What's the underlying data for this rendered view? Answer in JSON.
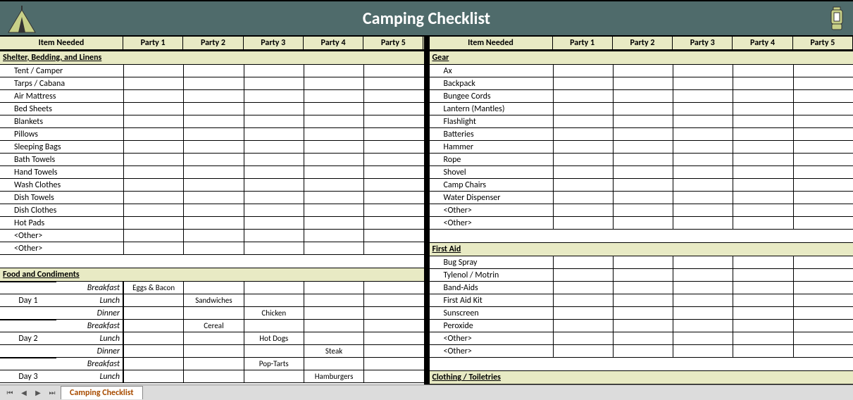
{
  "title": "Camping Checklist",
  "headers": {
    "item": "Item Needed",
    "parties": [
      "Party 1",
      "Party 2",
      "Party 3",
      "Party 4",
      "Party 5"
    ]
  },
  "left": {
    "sections": [
      {
        "name": "Shelter, Bedding, and Linens",
        "items": [
          "Tent / Camper",
          "Tarps / Cabana",
          "Air Mattress",
          "Bed Sheets",
          "Blankets",
          "Pillows",
          "Sleeping Bags",
          "Bath Towels",
          "Hand Towels",
          "Wash Clothes",
          "Dish Towels",
          "Dish Clothes",
          "Hot Pads",
          "<Other>",
          "<Other>"
        ]
      }
    ],
    "food": {
      "title": "Food and Condiments",
      "meals": [
        "Breakfast",
        "Lunch",
        "Dinner"
      ],
      "days": [
        {
          "label": "Day 1",
          "entries": [
            [
              "Eggs & Bacon",
              "",
              "",
              "",
              ""
            ],
            [
              "",
              "Sandwiches",
              "",
              "",
              ""
            ],
            [
              "",
              "",
              "Chicken",
              "",
              ""
            ]
          ]
        },
        {
          "label": "Day 2",
          "entries": [
            [
              "",
              "Cereal",
              "",
              "",
              ""
            ],
            [
              "",
              "",
              "Hot Dogs",
              "",
              ""
            ],
            [
              "",
              "",
              "",
              "Steak",
              ""
            ]
          ]
        },
        {
          "label": "Day 3",
          "entries": [
            [
              "",
              "",
              "Pop-Tarts",
              "",
              ""
            ],
            [
              "",
              "",
              "",
              "Hamburgers",
              ""
            ]
          ]
        }
      ]
    }
  },
  "right": {
    "sections": [
      {
        "name": "Gear",
        "items": [
          "Ax",
          "Backpack",
          "Bungee Cords",
          "Lantern (Mantles)",
          "Flashlight",
          "Batteries",
          "Hammer",
          "Rope",
          "Shovel",
          "Camp Chairs",
          "Water Dispenser",
          "<Other>",
          "<Other>"
        ]
      },
      {
        "name": "First Aid",
        "items": [
          "Bug Spray",
          "Tylenol / Motrin",
          "Band-Aids",
          "First Aid Kit",
          "Sunscreen",
          "Peroxide",
          "<Other>",
          "<Other>"
        ]
      },
      {
        "name": "Clothing / Toiletries",
        "items": []
      }
    ]
  },
  "sheet_tab": "Camping Checklist"
}
